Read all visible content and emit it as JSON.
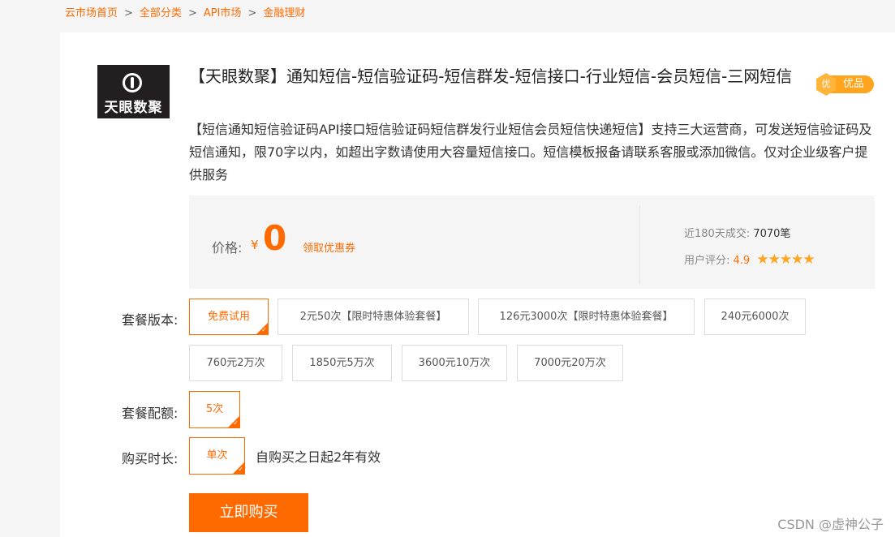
{
  "breadcrumb": [
    "云市场首页",
    "全部分类",
    "API市场",
    "金融理财"
  ],
  "breadcrumb_separator": ">",
  "product": {
    "logo_text": "天眼数聚",
    "title": "【天眼数聚】通知短信-短信验证码-短信群发-短信接口-行业短信-会员短信-三网短信",
    "badge": "优品",
    "badge_icon_text": "优",
    "description": "【短信通知短信验证码API接口短信验证码短信群发行业短信会员短信快递短信】支持三大运营商，可发送短信验证码及短信通知，限70字以内，如超出字数请使用大容量短信接口。短信模板报备请联系客服或添加微信。仅对企业级客户提供服务"
  },
  "price": {
    "label": "价格:",
    "currency": "¥",
    "value": "0",
    "coupon_link": "领取优惠券"
  },
  "stats": {
    "sales_label": "近180天成交:",
    "sales_value": "7070笔",
    "rating_label": "用户评分:",
    "rating_value": "4.9",
    "stars": "★★★★★"
  },
  "plan": {
    "label": "套餐版本:",
    "options": [
      "免费试用",
      "2元50次【限时特惠体验套餐】",
      "126元3000次【限时特惠体验套餐】",
      "240元6000次",
      "760元2万次",
      "1850元5万次",
      "3600元10万次",
      "7000元20万次"
    ],
    "selected": "免费试用"
  },
  "quota": {
    "label": "套餐配额:",
    "options": [
      "5次"
    ],
    "selected": "5次"
  },
  "duration": {
    "label": "购买时长:",
    "options": [
      "单次"
    ],
    "selected": "单次",
    "validity": "自购买之日起2年有效"
  },
  "buy_button": "立即购买",
  "watermark": "CSDN @虚神公子",
  "colors": {
    "accent": "#ff6a00",
    "badge": "#ffa41c"
  }
}
